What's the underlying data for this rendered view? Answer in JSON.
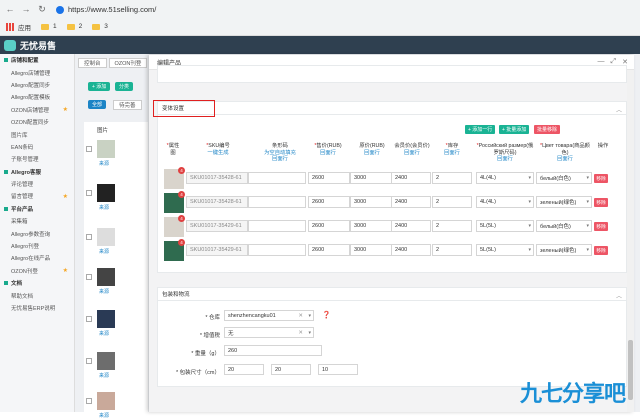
{
  "browser": {
    "url": "https://www.51selling.com/",
    "bookmarks": [
      "应用",
      "1",
      "2",
      "3"
    ]
  },
  "app": {
    "name": "无忧易售"
  },
  "sidebar": {
    "items": [
      {
        "label": "店铺和配置",
        "group": true
      },
      {
        "label": "Allegro店铺管理"
      },
      {
        "label": "Allegro配置同步"
      },
      {
        "label": "Allegro配置模板"
      },
      {
        "label": "OZON店铺管理",
        "star": true
      },
      {
        "label": "OZON配置同步"
      },
      {
        "label": "图片库"
      },
      {
        "label": "EAN条码"
      },
      {
        "label": "子账号管理"
      },
      {
        "label": "Allegro客服",
        "group": true
      },
      {
        "label": "评论管理"
      },
      {
        "label": "留言管理",
        "star": true
      },
      {
        "label": "平台产品",
        "group": true
      },
      {
        "label": "采集箱"
      },
      {
        "label": "Allegro参数查询"
      },
      {
        "label": "Allegro刊登"
      },
      {
        "label": "Allegro在线产品"
      },
      {
        "label": "OZON刊登",
        "star": true
      },
      {
        "label": "文档",
        "group": true
      },
      {
        "label": "帮助文档"
      },
      {
        "label": "无忧易售ERP说明"
      }
    ]
  },
  "bg": {
    "tabs": [
      "控制台",
      "OZON刊登"
    ],
    "btn_add": "+ 添加",
    "btn_cat": "分类",
    "filter_all": "全部",
    "filter_wait": "待完善",
    "col_img": "图片",
    "source": "来源"
  },
  "modal": {
    "title": "编辑产品",
    "variant_title": "变体设置",
    "pack_title": "包装和物流"
  },
  "actions": {
    "add_row": "+ 添加一行",
    "batch_add": "+ 批量添加",
    "batch_remove": "批量移除"
  },
  "headers": {
    "attr": "属性图",
    "sku": "SKU编号",
    "sku_sub": "一键生成",
    "barcode": "条形码",
    "barcode_sub": "为空自动填充",
    "barcode_sub2": "回面行",
    "price": "售价(RUB)",
    "price_sub": "回面行",
    "orig": "原价(RUB)",
    "orig_sub": "回面行",
    "member": "会员价(会员价)",
    "member_sub": "回面行",
    "stock": "库存",
    "stock_sub": "回面行",
    "size": "Российский размер(俄罗斯尺码)",
    "size_sub": "回面行",
    "color": "Цвет товара(商品颜色)",
    "color_sub": "回面行",
    "op": "操作"
  },
  "rows": [
    {
      "sku": "SKU01017-35428-61",
      "price": "2600",
      "orig": "3000",
      "member": "2400",
      "stock": "2",
      "size": "4L(4L)",
      "color": "белый(白色)",
      "remove": "移除",
      "badge": "4"
    },
    {
      "sku": "SKU01017-35428-61",
      "price": "2600",
      "orig": "3000",
      "member": "2400",
      "stock": "2",
      "size": "4L(4L)",
      "color": "зеленый(绿色)",
      "remove": "移除",
      "badge": "4"
    },
    {
      "sku": "SKU01017-35429-61",
      "price": "2600",
      "orig": "3000",
      "member": "2400",
      "stock": "2",
      "size": "5L(5L)",
      "color": "белый(白色)",
      "remove": "移除",
      "badge": "4"
    },
    {
      "sku": "SKU01017-35429-61",
      "price": "2600",
      "orig": "3000",
      "member": "2400",
      "stock": "2",
      "size": "5L(5L)",
      "color": "зеленый(绿色)",
      "remove": "移除",
      "badge": "4"
    }
  ],
  "pack": {
    "warehouse_label": "* 仓库",
    "warehouse": "shenzhencangku01",
    "vat_label": "* 增值税",
    "vat": "无",
    "weight_label": "* 重量（g）",
    "weight": "260",
    "dims_label": "* 包装尺寸（cm）",
    "dims": [
      "20",
      "20",
      "10"
    ]
  },
  "watermark": "九七分享吧",
  "colors": {
    "accent": "#1ab394",
    "danger": "#ed5565",
    "link": "#1c84c6",
    "nav": "#2f4050"
  }
}
